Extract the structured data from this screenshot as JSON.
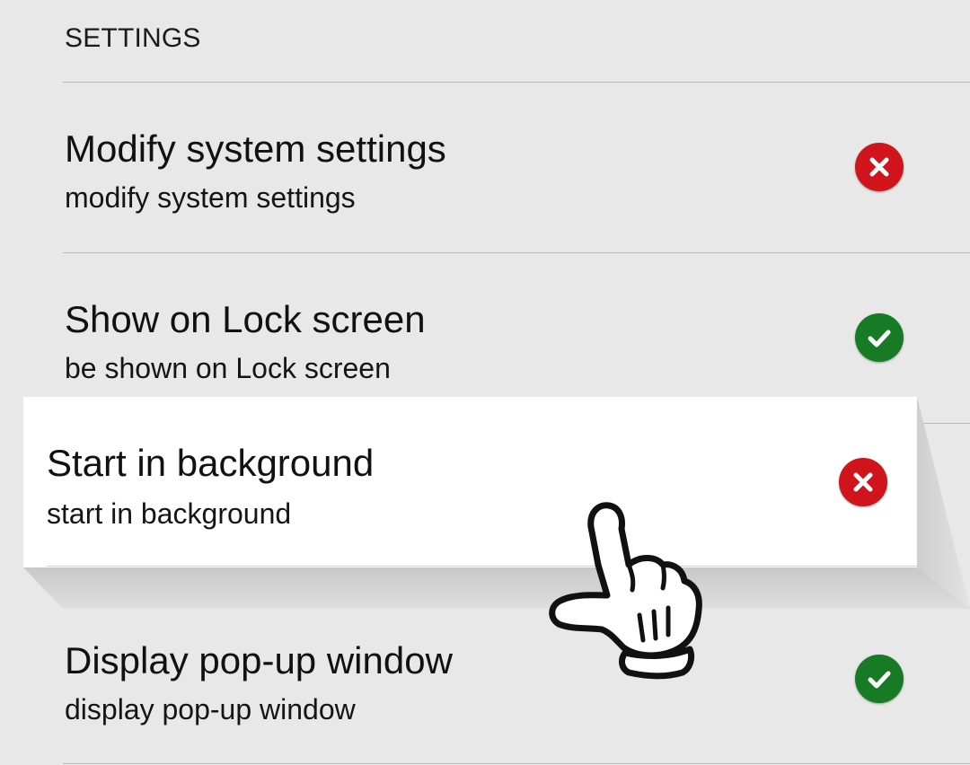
{
  "section": {
    "header": "SETTINGS"
  },
  "permissions": [
    {
      "title": "Modify system settings",
      "subtitle": "modify system settings",
      "status": "denied",
      "status_icon": "x-icon"
    },
    {
      "title": "Show on Lock screen",
      "subtitle": "be shown on Lock screen",
      "status": "allowed",
      "status_icon": "check-icon"
    },
    {
      "title": "Start in background",
      "subtitle": "start in background",
      "status": "denied",
      "status_icon": "x-icon",
      "highlighted": true
    },
    {
      "title": "Display pop-up window",
      "subtitle": "display pop-up window",
      "status": "allowed",
      "status_icon": "check-icon"
    }
  ],
  "colors": {
    "background": "#e8e8e8",
    "card": "#ffffff",
    "denied": "#d0141c",
    "allowed": "#177a24",
    "divider": "#b9b9b9"
  },
  "pointer": {
    "icon": "tapping-hand-icon"
  }
}
